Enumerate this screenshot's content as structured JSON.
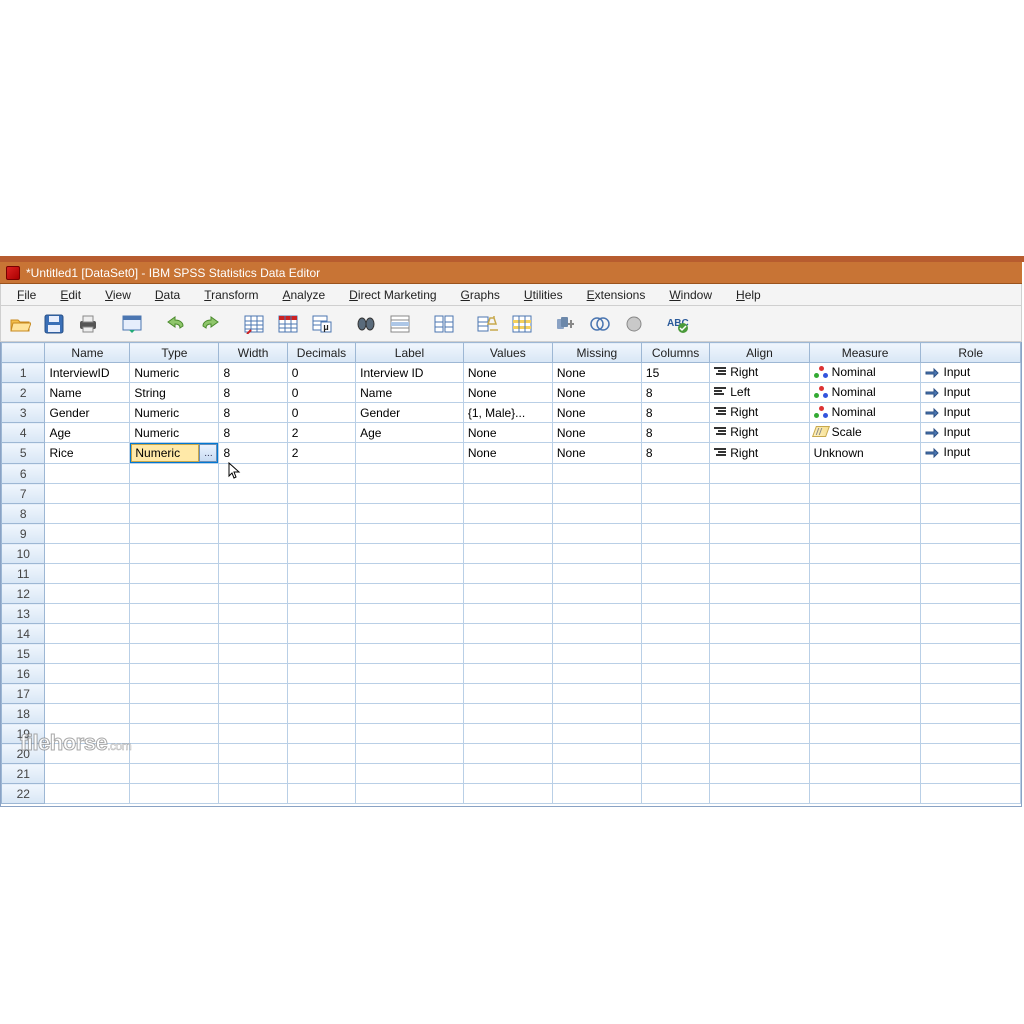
{
  "window": {
    "title": "*Untitled1 [DataSet0] - IBM SPSS Statistics Data Editor"
  },
  "menu": {
    "items": [
      "File",
      "Edit",
      "View",
      "Data",
      "Transform",
      "Analyze",
      "Direct Marketing",
      "Graphs",
      "Utilities",
      "Extensions",
      "Window",
      "Help"
    ]
  },
  "toolbar": {
    "buttons": [
      "open",
      "save",
      "print",
      "recall",
      "undo",
      "redo",
      "goto-case",
      "goto-variable",
      "variables",
      "find",
      "split-file",
      "weight",
      "select-cases",
      "value-labels",
      "insert-case",
      "use-sets",
      "show-all",
      "spellcheck"
    ]
  },
  "columns": {
    "rownum": "",
    "name": "Name",
    "type": "Type",
    "width": "Width",
    "decimals": "Decimals",
    "label": "Label",
    "values": "Values",
    "missing": "Missing",
    "cols": "Columns",
    "align": "Align",
    "measure": "Measure",
    "role": "Role"
  },
  "rows": [
    {
      "n": "1",
      "name": "InterviewID",
      "type": "Numeric",
      "width": "8",
      "decimals": "0",
      "label": "Interview ID",
      "values": "None",
      "missing": "None",
      "cols": "15",
      "align": "Right",
      "measure": "Nominal",
      "role": "Input"
    },
    {
      "n": "2",
      "name": "Name",
      "type": "String",
      "width": "8",
      "decimals": "0",
      "label": "Name",
      "values": "None",
      "missing": "None",
      "cols": "8",
      "align": "Left",
      "measure": "Nominal",
      "role": "Input"
    },
    {
      "n": "3",
      "name": "Gender",
      "type": "Numeric",
      "width": "8",
      "decimals": "0",
      "label": "Gender",
      "values": "{1, Male}...",
      "missing": "None",
      "cols": "8",
      "align": "Right",
      "measure": "Nominal",
      "role": "Input"
    },
    {
      "n": "4",
      "name": "Age",
      "type": "Numeric",
      "width": "8",
      "decimals": "2",
      "label": "Age",
      "values": "None",
      "missing": "None",
      "cols": "8",
      "align": "Right",
      "measure": "Scale",
      "role": "Input"
    },
    {
      "n": "5",
      "name": "Rice",
      "type": "Numeric",
      "width": "8",
      "decimals": "2",
      "label": "",
      "values": "None",
      "missing": "None",
      "cols": "8",
      "align": "Right",
      "measure": "Unknown",
      "role": "Input",
      "editing": true
    }
  ],
  "empty_row_start": 6,
  "empty_row_end": 22,
  "cell_button": "...",
  "watermark": {
    "main": "filehorse",
    "suffix": ".com"
  }
}
